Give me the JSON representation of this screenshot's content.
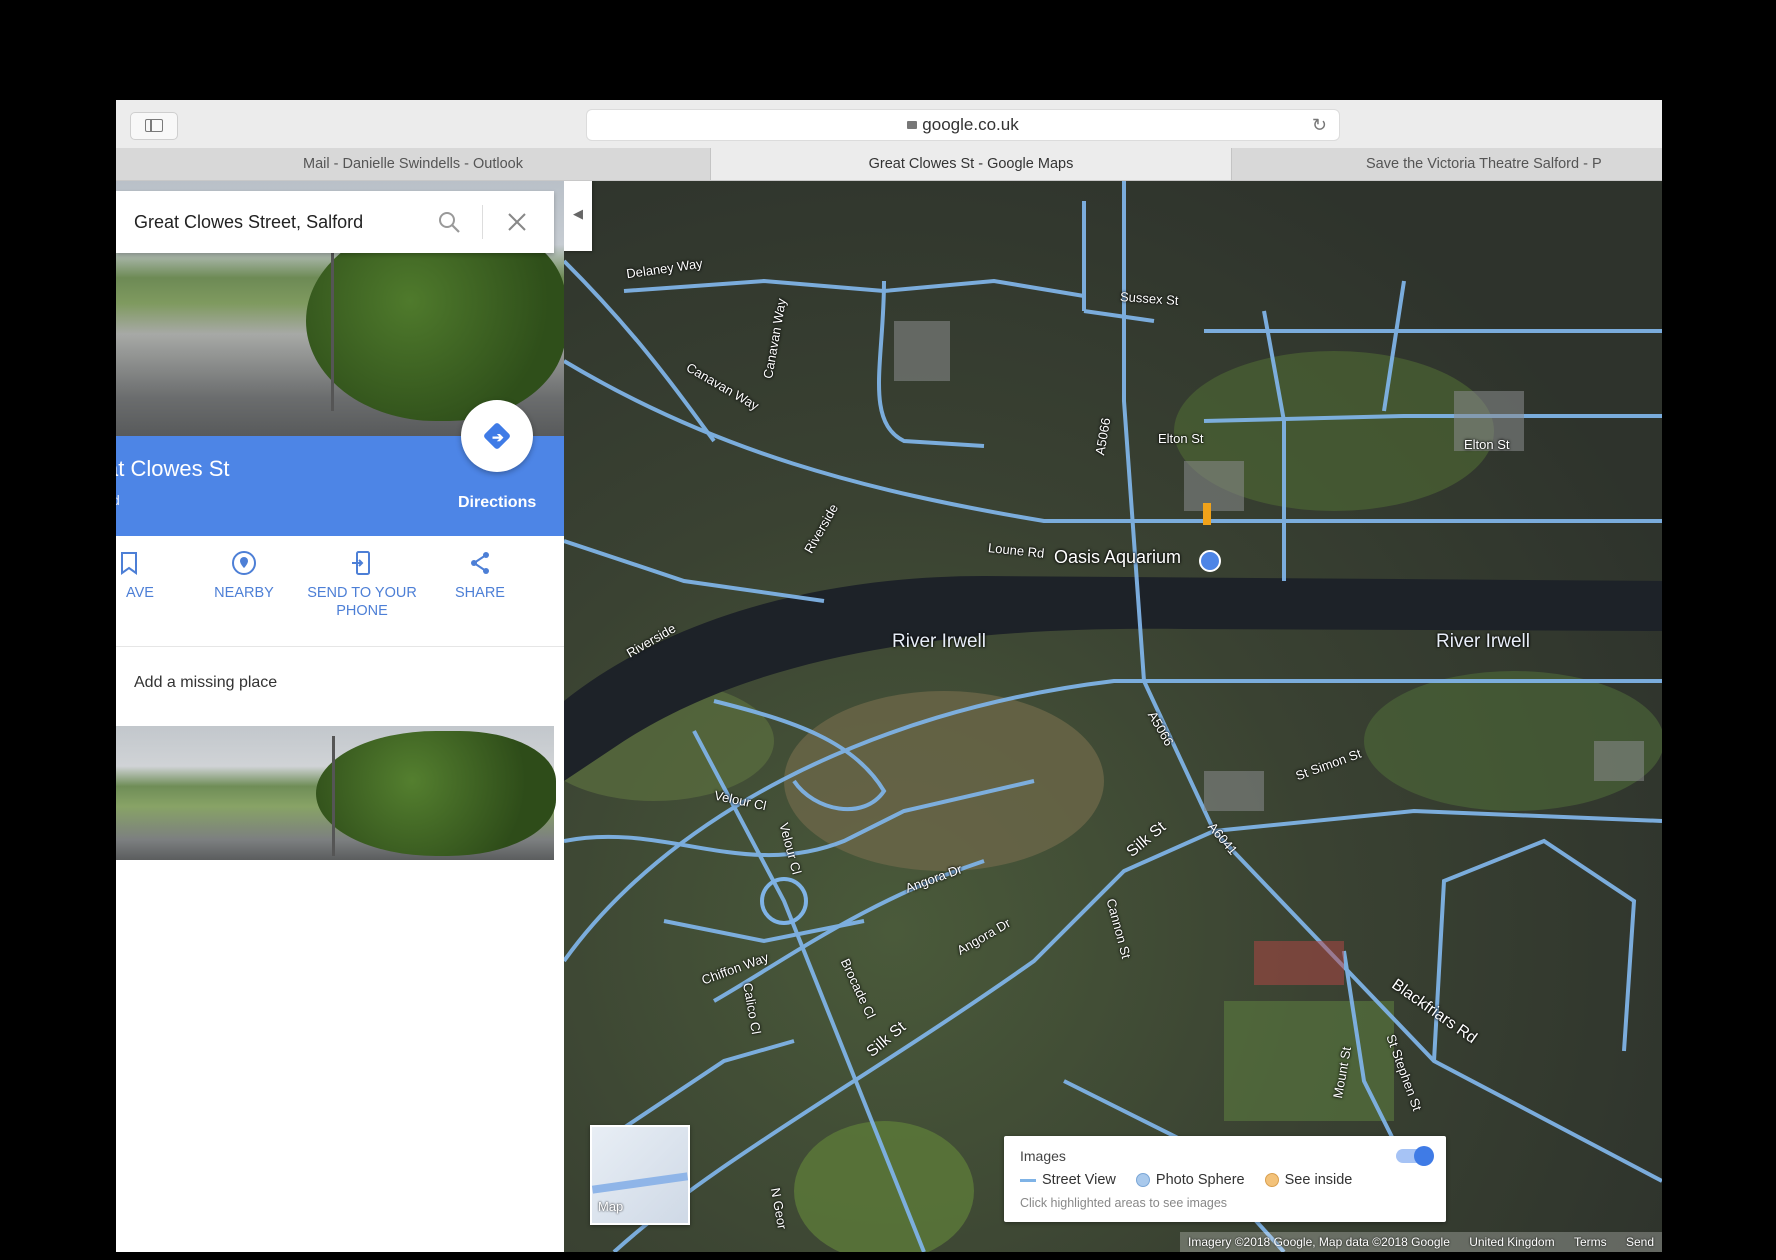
{
  "browser": {
    "url": "google.co.uk",
    "tabs": [
      {
        "label": "Mail - Danielle Swindells - Outlook"
      },
      {
        "label": "Great Clowes St - Google Maps"
      },
      {
        "label": "Save the Victoria Theatre Salford - P"
      }
    ]
  },
  "panel": {
    "search_value": "Great Clowes Street, Salford",
    "place_name": "at Clowes St",
    "place_sub": "d",
    "directions_label": "Directions",
    "actions": [
      {
        "label": "AVE",
        "icon": "bookmark-icon"
      },
      {
        "label": "NEARBY",
        "icon": "location-pin-icon"
      },
      {
        "label": "SEND TO YOUR PHONE",
        "icon": "send-to-phone-icon"
      },
      {
        "label": "SHARE",
        "icon": "share-icon"
      }
    ],
    "add_missing": "Add a missing place"
  },
  "map": {
    "rivers": [
      "River Irwell",
      "River Irwell"
    ],
    "streets": [
      "Delaney Way",
      "Sussex St",
      "Elton St",
      "Elton St",
      "Canavan Way",
      "Canavan Way",
      "Riverside",
      "Riverside",
      "A5066",
      "A5066",
      "Loune Rd",
      "St Simon St",
      "Silk St",
      "Silk St",
      "A6041",
      "Velour Cl",
      "Velour Cl",
      "Angora Dr",
      "Angora Dr",
      "Chiffon Way",
      "Calico Cl",
      "Brocade Cl",
      "Cannon St",
      "Blackfriars Rd",
      "St Stephen St",
      "Mount St",
      "N Geor"
    ],
    "poi": "Oasis Aquarium",
    "minimap_label": "Map",
    "images_card": {
      "title": "Images",
      "legend": [
        {
          "label": "Street View",
          "color": "#7fb3e6"
        },
        {
          "label": "Photo Sphere",
          "color": "#a9c9ec"
        },
        {
          "label": "See inside",
          "color": "#f3c27a"
        }
      ],
      "hint": "Click highlighted areas to see images"
    },
    "attribution": [
      "Imagery ©2018 Google, Map data ©2018 Google",
      "United Kingdom",
      "Terms",
      "Send"
    ]
  }
}
